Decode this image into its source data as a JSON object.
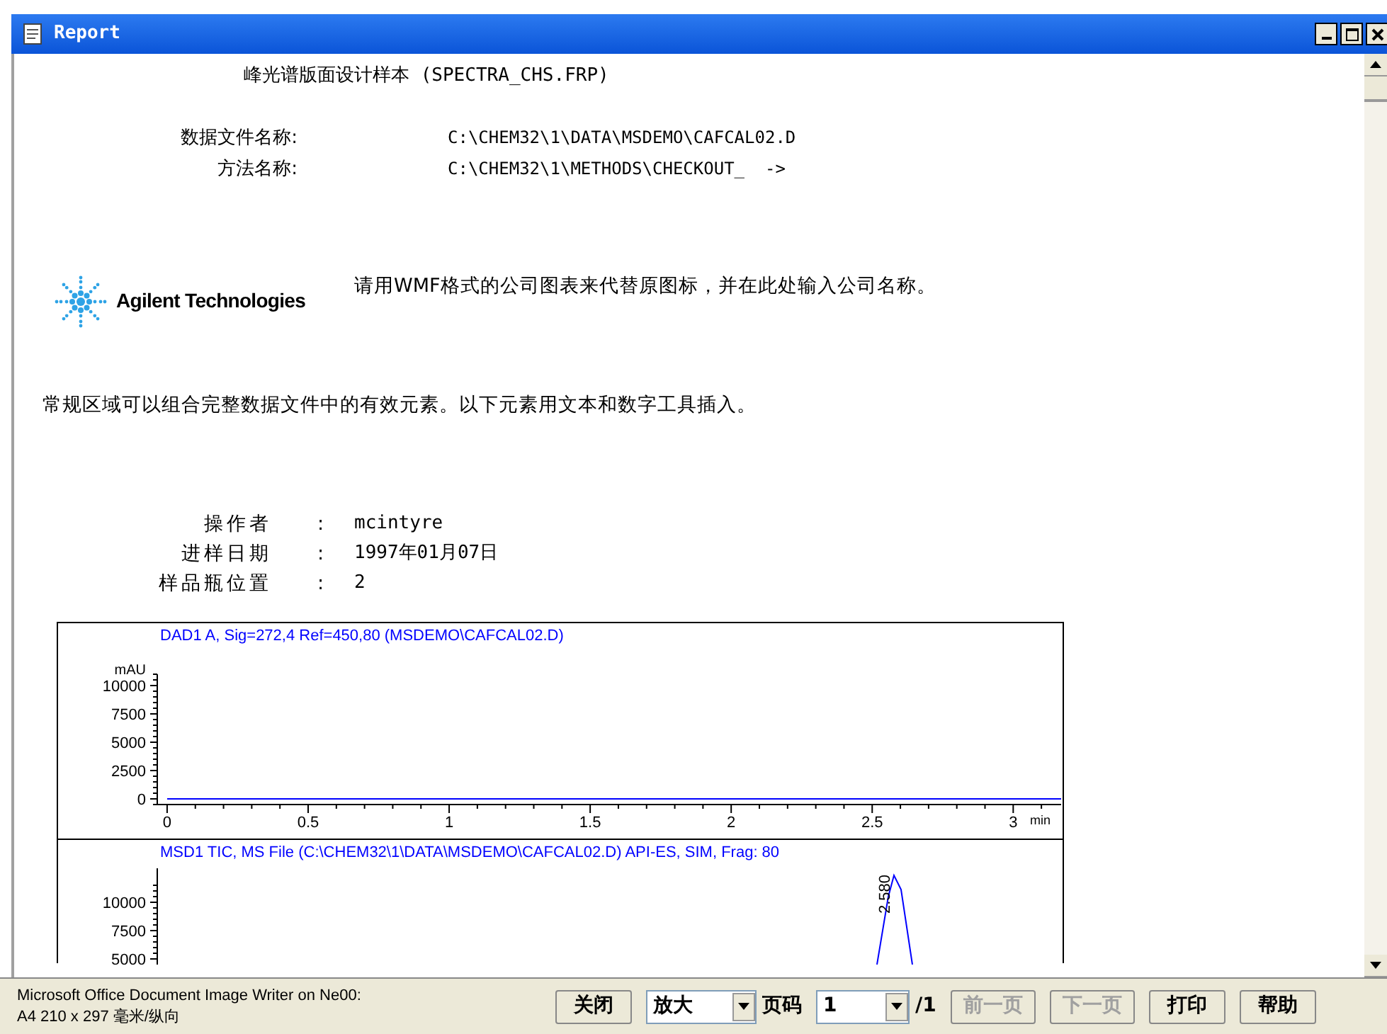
{
  "window": {
    "title": "Report"
  },
  "report": {
    "heading": "峰光谱版面设计样本 (SPECTRA_CHS.FRP)",
    "file_fields": [
      {
        "label": "数据文件名称:",
        "value": "C:\\CHEM32\\1\\DATA\\MSDEMO\\CAFCAL02.D"
      },
      {
        "label": "方法名称:",
        "value": "C:\\CHEM32\\1\\METHODS\\CHECKOUT_  ->"
      }
    ],
    "logo_text": "Agilent Technologies",
    "logo_note": "请用WMF格式的公司图表来代替原图标，并在此处输入公司名称。",
    "intro": "常规区域可以组合完整数据文件中的有效元素。以下元素用文本和数字工具插入。",
    "sample_fields": [
      {
        "label": "操作者",
        "separator": ":",
        "value": "mcintyre"
      },
      {
        "label": "进样日期",
        "separator": ":",
        "value": "1997年01月07日"
      },
      {
        "label": "样品瓶位置",
        "separator": ":",
        "value": "2"
      }
    ],
    "charts": [
      {
        "chart_data": {
          "type": "line",
          "title": "DAD1 A, Sig=272,4 Ref=450,80 (MSDEMO\\CAFCAL02.D)",
          "xlabel": "min",
          "ylabel": "mAU",
          "x": [
            0,
            3.17
          ],
          "series": [
            {
              "color": "#0000ff",
              "values": [
                0,
                0
              ]
            }
          ],
          "xlim": [
            -0.035,
            3.17
          ],
          "ylim": [
            -500,
            11000
          ],
          "xticks": [
            {
              "value": 0,
              "label": "0"
            },
            {
              "value": 0.5,
              "label": "0.5"
            },
            {
              "value": 1,
              "label": "1"
            },
            {
              "value": 1.5,
              "label": "1.5"
            },
            {
              "value": 2,
              "label": "2"
            },
            {
              "value": 2.5,
              "label": "2.5"
            },
            {
              "value": 3,
              "label": "3"
            }
          ],
          "yticks": [
            0,
            2500,
            5000,
            7500,
            10000
          ]
        }
      },
      {
        "kind": "picture",
        "title": "MSD1 TIC, MS File (C:\\CHEM32\\1\\DATA\\MSDEMO\\CAFCAL02.D)  API-ES, SIM, Frag: 80",
        "axis_labels": [
          "10000",
          "7500",
          "5000"
        ],
        "peak_label": "2.580"
      }
    ]
  },
  "status_bar": {
    "printer_lines": [
      "Microsoft Office Document Image Writer on Ne00:",
      "A4 210 x 297 毫米/纵向"
    ],
    "controls": [
      {
        "kind": "button",
        "label": "关闭",
        "disabled": false
      },
      {
        "kind": "select",
        "value": "放大"
      },
      {
        "kind": "label",
        "label": "页码"
      },
      {
        "kind": "select",
        "value": "1"
      },
      {
        "kind": "label",
        "label": "/1"
      },
      {
        "kind": "button",
        "label": "前一页",
        "disabled": true
      },
      {
        "kind": "button",
        "label": "下一页",
        "disabled": true
      },
      {
        "kind": "button",
        "label": "打印",
        "disabled": false
      },
      {
        "kind": "button",
        "label": "帮助",
        "disabled": false
      }
    ]
  }
}
